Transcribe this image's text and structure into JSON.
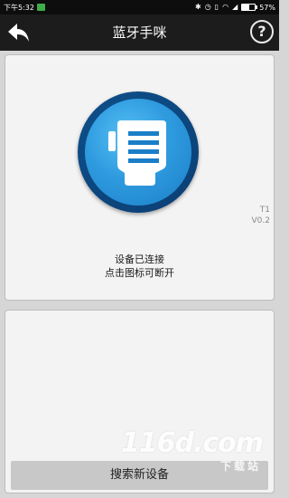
{
  "status_bar": {
    "time": "下午5:32",
    "battery": "57%",
    "battery_fraction": 0.57,
    "icons": [
      "app-badge-icon",
      "bluetooth-icon",
      "alarm-icon",
      "vibrate-icon",
      "wifi-icon",
      "signal-icon",
      "battery-icon"
    ]
  },
  "header": {
    "title": "蓝牙手咪",
    "back_icon": "back-arrow-icon",
    "help_icon": "help-icon",
    "help_glyph": "?"
  },
  "device_panel": {
    "model": "T1",
    "version": "V0.2",
    "status_line1": "设备已连接",
    "status_line2": "点击图标可断开",
    "icon": "walkie-talkie-icon",
    "accent_color": "#2f9bdf"
  },
  "search_panel": {
    "button_label": "搜索新设备"
  },
  "watermark": {
    "brand": "116d.com",
    "subtitle": "下载站"
  }
}
